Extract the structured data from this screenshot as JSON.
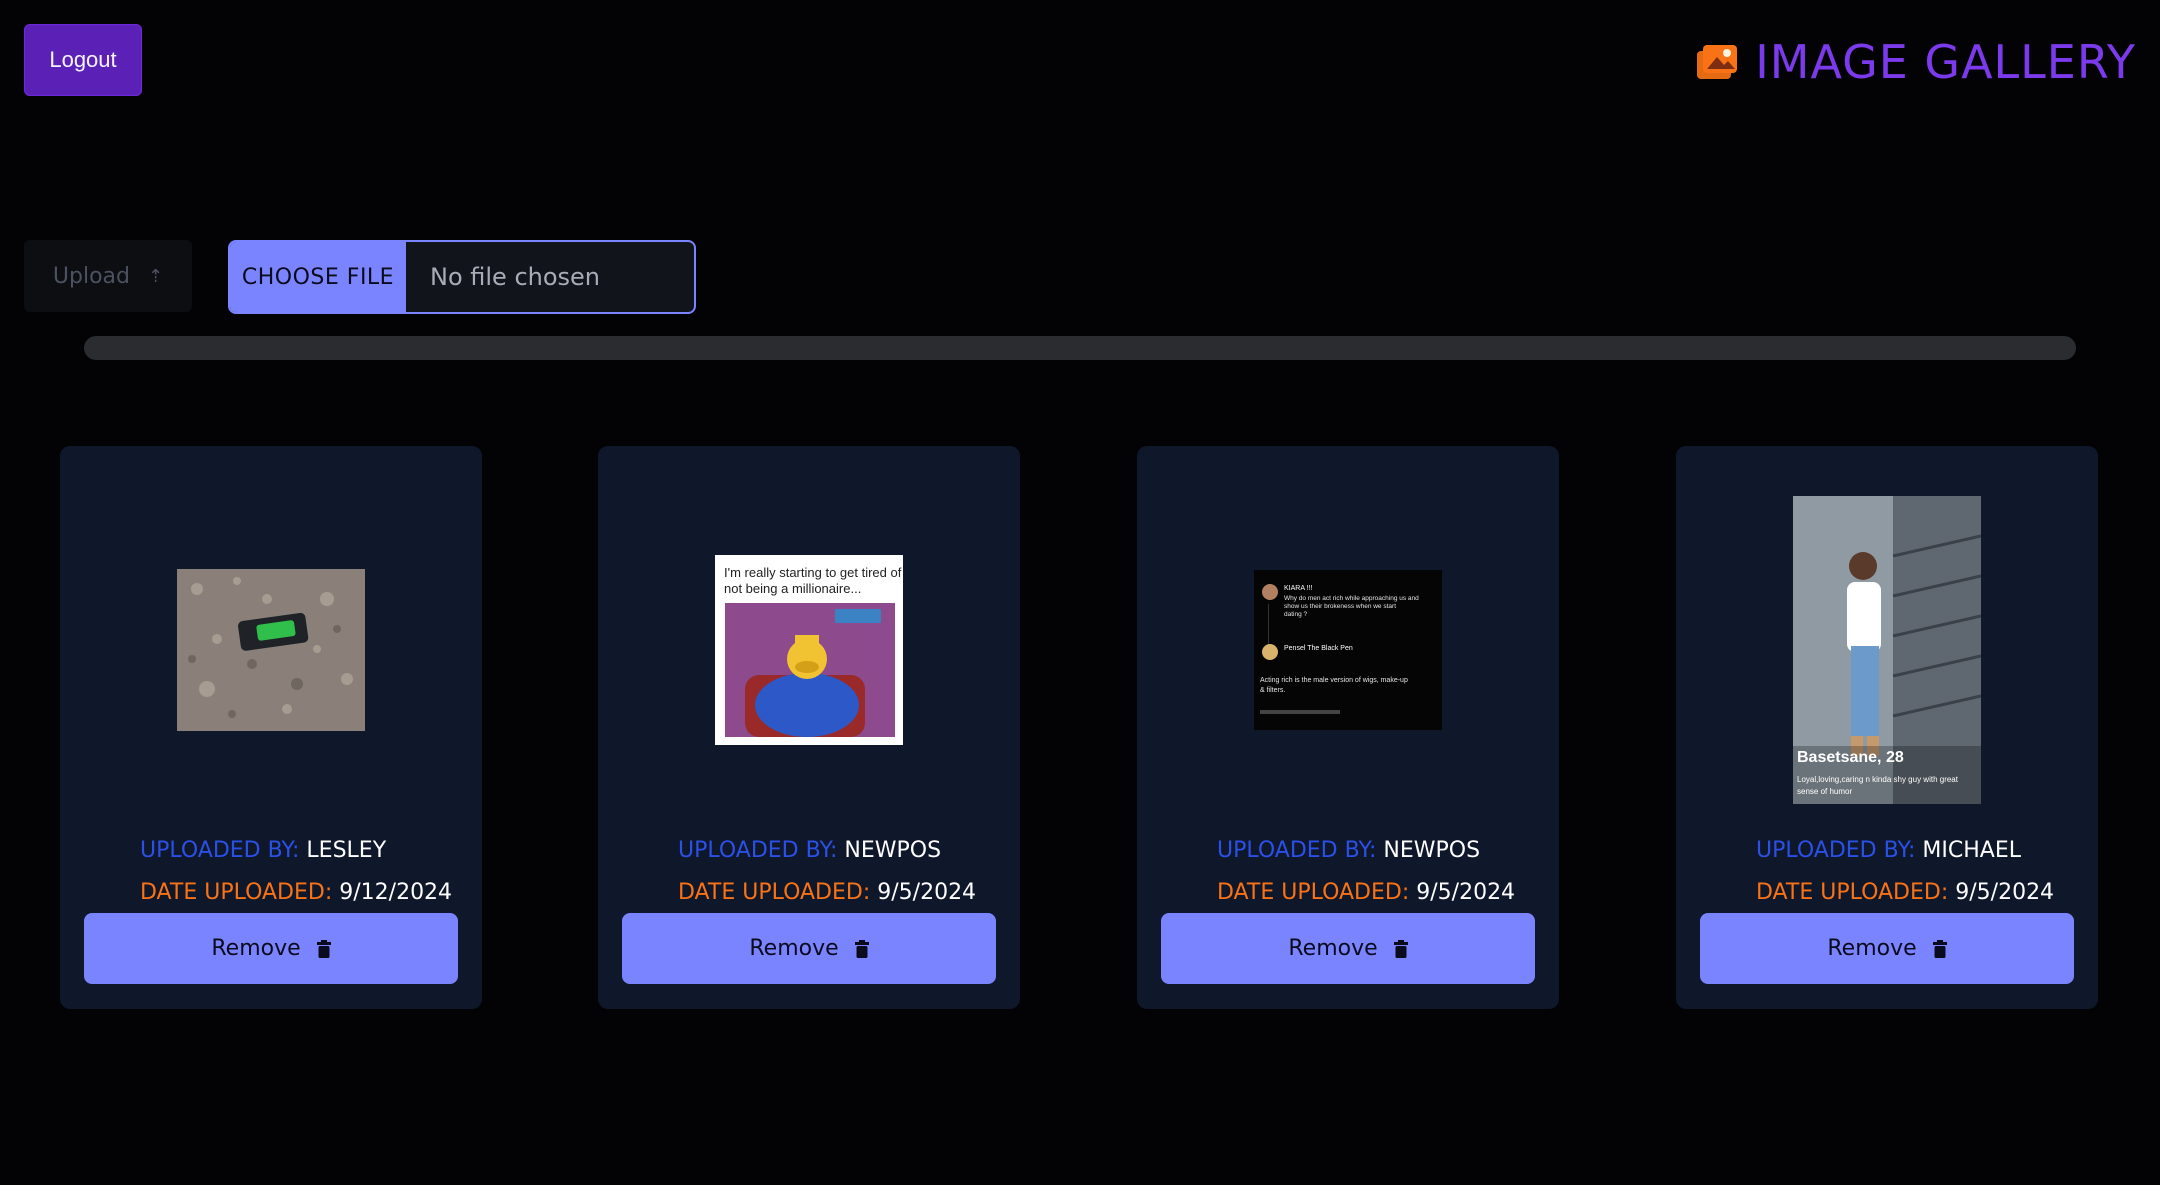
{
  "header": {
    "logout_label": "Logout",
    "title": "IMAGE GALLERY",
    "icon": "images-icon"
  },
  "upload": {
    "button_label": "Upload",
    "button_icon": "arrow-up-icon",
    "choose_file_label": "CHOOSE FILE",
    "file_status": "No file chosen",
    "progress": 0
  },
  "labels": {
    "uploaded_by": "UPLOADED BY:",
    "date_uploaded": "DATE UPLOADED:",
    "remove": "Remove"
  },
  "cards": [
    {
      "uploaded_by": "LESLEY",
      "date": "9/12/2024"
    },
    {
      "uploaded_by": "NEWPOS",
      "date": "9/5/2024",
      "image_text": "I'm really starting to get tired of not being a millionaire..."
    },
    {
      "uploaded_by": "NEWPOS",
      "date": "9/5/2024",
      "image_text": [
        "KIARA !!!",
        "Why do men act rich while approaching us and show us their brokeness when we start dating ?",
        "Pensel The Black Pen",
        "Acting rich is the male version of wigs, make-up & filters."
      ]
    },
    {
      "uploaded_by": "MICHAEL",
      "date": "9/5/2024",
      "image_text": [
        "Basetsane, 28",
        "Loyal,loving,caring n kinda shy guy with great sense of humor"
      ]
    }
  ],
  "colors": {
    "accent": "#7b84ff",
    "brand": "#7c3aed",
    "logout": "#5b21b6",
    "card_bg": "#0f172a",
    "label_blue": "#2b50e8",
    "label_orange": "#f97316"
  }
}
